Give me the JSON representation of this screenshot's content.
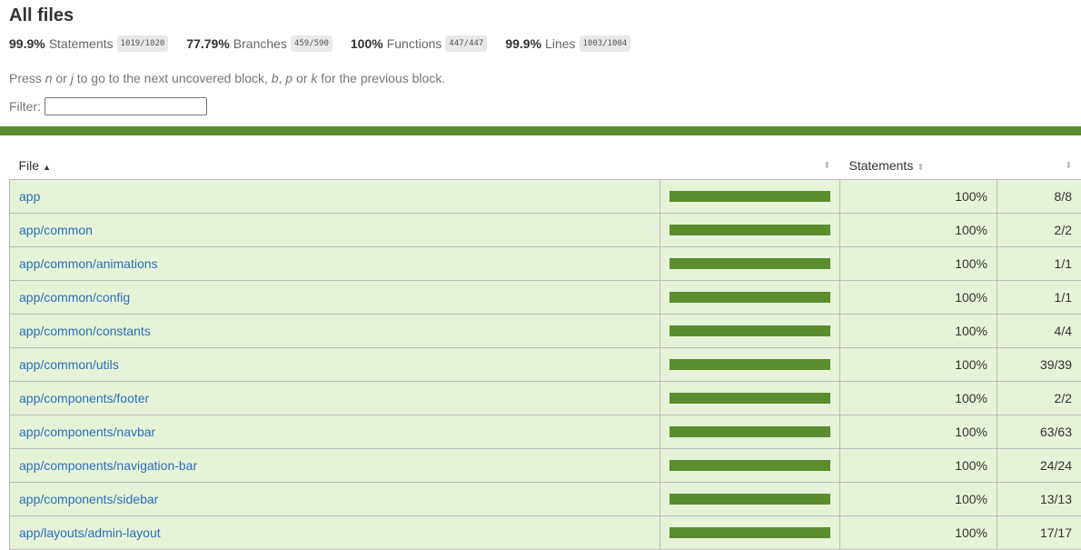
{
  "title": "All files",
  "summary": [
    {
      "pct": "99.9%",
      "label": "Statements",
      "frac": "1019/1020"
    },
    {
      "pct": "77.79%",
      "label": "Branches",
      "frac": "459/590"
    },
    {
      "pct": "100%",
      "label": "Functions",
      "frac": "447/447"
    },
    {
      "pct": "99.9%",
      "label": "Lines",
      "frac": "1003/1004"
    }
  ],
  "hint": {
    "press": "Press ",
    "n": "n",
    "or1": " or ",
    "j": "j",
    "mid": " to go to the next uncovered block, ",
    "b": "b",
    "comma": ", ",
    "p": "p",
    "or2": " or ",
    "k": "k",
    "end": " for the previous block."
  },
  "filter": {
    "label": "Filter:",
    "value": ""
  },
  "accent": "#5b8c2e",
  "row_bg": "#e7f3d8",
  "link_color": "#2a6fb8",
  "table": {
    "headers": {
      "file": "File",
      "statements": "Statements"
    },
    "rows": [
      {
        "file": "app",
        "coverage": 1.0,
        "pct": "100%",
        "abs": "8/8"
      },
      {
        "file": "app/common",
        "coverage": 1.0,
        "pct": "100%",
        "abs": "2/2"
      },
      {
        "file": "app/common/animations",
        "coverage": 1.0,
        "pct": "100%",
        "abs": "1/1"
      },
      {
        "file": "app/common/config",
        "coverage": 1.0,
        "pct": "100%",
        "abs": "1/1"
      },
      {
        "file": "app/common/constants",
        "coverage": 1.0,
        "pct": "100%",
        "abs": "4/4"
      },
      {
        "file": "app/common/utils",
        "coverage": 1.0,
        "pct": "100%",
        "abs": "39/39"
      },
      {
        "file": "app/components/footer",
        "coverage": 1.0,
        "pct": "100%",
        "abs": "2/2"
      },
      {
        "file": "app/components/navbar",
        "coverage": 1.0,
        "pct": "100%",
        "abs": "63/63"
      },
      {
        "file": "app/components/navigation-bar",
        "coverage": 1.0,
        "pct": "100%",
        "abs": "24/24"
      },
      {
        "file": "app/components/sidebar",
        "coverage": 1.0,
        "pct": "100%",
        "abs": "13/13"
      },
      {
        "file": "app/layouts/admin-layout",
        "coverage": 1.0,
        "pct": "100%",
        "abs": "17/17"
      }
    ]
  }
}
